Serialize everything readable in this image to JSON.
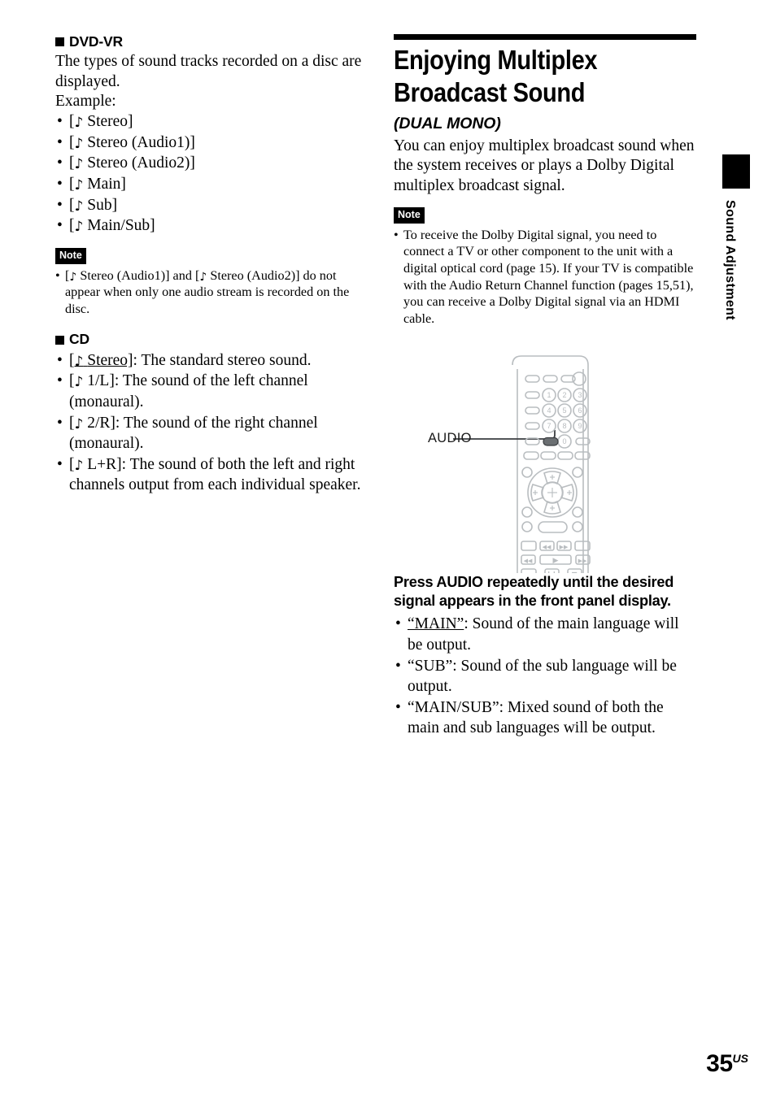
{
  "left_column": {
    "dvdvr_section": {
      "heading": "DVD-VR",
      "intro": "The types of sound tracks recorded on a disc are displayed.",
      "example_label": "Example:",
      "items": [
        "Stereo]",
        "Stereo (Audio1)]",
        "Stereo (Audio2)]",
        "Main]",
        "Sub]",
        "Main/Sub]"
      ],
      "note": {
        "badge": "Note",
        "text_pre": "[",
        "text_mid": "Stereo (Audio1)] and [",
        "text_post": "Stereo (Audio2)] do not appear when only one audio stream is recorded on the disc."
      }
    },
    "cd_section": {
      "heading": "CD",
      "items": [
        {
          "term": "Stereo]",
          "desc": ": The standard stereo sound."
        },
        {
          "term": "1/L]",
          "desc": ": The sound of the left channel (monaural)."
        },
        {
          "term": "2/R]",
          "desc": ": The sound of the right channel (monaural)."
        },
        {
          "term": "L+R]",
          "desc": ": The sound of both the left and right channels output from each individual speaker."
        }
      ]
    }
  },
  "right_column": {
    "title": "Enjoying Multiplex Broadcast Sound",
    "subtitle": "(DUAL MONO)",
    "intro": "You can enjoy multiplex broadcast sound when the system receives or plays a Dolby Digital multiplex broadcast signal.",
    "note": {
      "badge": "Note",
      "text": "To receive the Dolby Digital signal, you need to connect a TV or other component to the unit with a digital optical cord (page 15). If your TV is compatible with the Audio Return Channel function (pages 15,51), you can receive a Dolby Digital signal via an HDMI cable."
    },
    "figure": {
      "callout_label": "AUDIO",
      "keypad_digits": [
        "1",
        "2",
        "3",
        "4",
        "5",
        "6",
        "7",
        "8",
        "9",
        "0"
      ]
    },
    "instruction": "Press AUDIO repeatedly until the desired signal appears in the front panel display.",
    "instruction_items": [
      {
        "term": "“MAIN”",
        "desc": ": Sound of the main language will be output.",
        "underlined": true
      },
      {
        "term": "“SUB”",
        "desc": ": Sound of the sub language will be output.",
        "underlined": false
      },
      {
        "term": "“MAIN/SUB”",
        "desc": ": Mixed sound of both the main and sub languages will be output.",
        "underlined": false
      }
    ]
  },
  "side_tab": {
    "label": "Sound Adjustment"
  },
  "page_footer": {
    "number": "35",
    "region": "US"
  },
  "colors": {
    "text": "#000000",
    "accent_bar": "#000000",
    "remote_outline": "#b9bdc0",
    "remote_highlight": "#6b6f72"
  }
}
